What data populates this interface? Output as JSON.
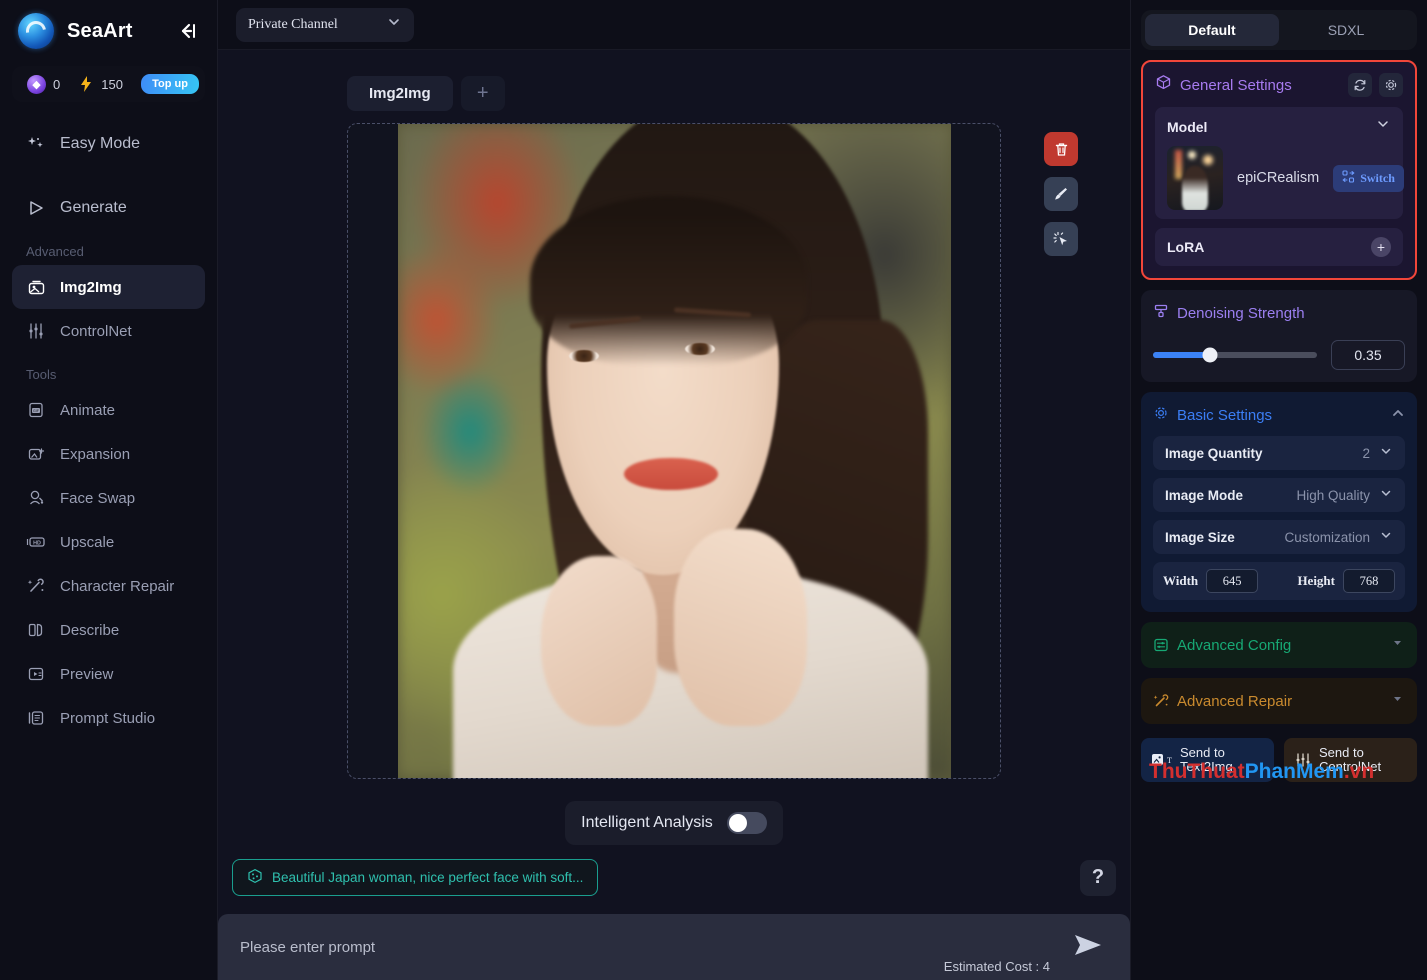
{
  "sidebar": {
    "brand": "SeaArt",
    "collapse_icon": "collapse-left-icon",
    "credits": {
      "gem_icon": "gem-icon",
      "gem_value": "0",
      "bolt_icon": "bolt-icon",
      "bolt_value": "150",
      "topup_label": "Top up"
    },
    "primary": [
      {
        "label": "Easy Mode",
        "icon": "sparkles-icon"
      },
      {
        "label": "Generate",
        "icon": "play-icon"
      }
    ],
    "advanced_label": "Advanced",
    "advanced": [
      {
        "label": "Img2Img",
        "icon": "img2img-icon",
        "active": true
      },
      {
        "label": "ControlNet",
        "icon": "sliders-icon",
        "active": false
      }
    ],
    "tools_label": "Tools",
    "tools": [
      {
        "label": "Animate",
        "icon": "gif-icon"
      },
      {
        "label": "Expansion",
        "icon": "expand-image-icon"
      },
      {
        "label": "Face Swap",
        "icon": "face-swap-icon"
      },
      {
        "label": "Upscale",
        "icon": "hd-icon"
      },
      {
        "label": "Character Repair",
        "icon": "wand-repair-icon"
      },
      {
        "label": "Describe",
        "icon": "book-icon"
      },
      {
        "label": "Preview",
        "icon": "preview-icon"
      },
      {
        "label": "Prompt Studio",
        "icon": "prompt-studio-icon"
      }
    ]
  },
  "topbar": {
    "channel_value": "Private Channel",
    "channel_chevron": "chevron-down-icon"
  },
  "canvas": {
    "tab_label": "Img2Img",
    "add_tab_label": "+",
    "image_alt": "uploaded portrait photo of a young woman",
    "tools": [
      {
        "name": "delete-image-button",
        "icon": "trash-icon"
      },
      {
        "name": "inpaint-brush-button",
        "icon": "brush-icon"
      },
      {
        "name": "magic-select-button",
        "icon": "magic-cursor-icon"
      }
    ],
    "intelligent_analysis_label": "Intelligent Analysis",
    "intelligent_analysis_on": false,
    "prompt_chip": "Beautiful Japan woman, nice perfect face with soft...",
    "prompt_chip_icon": "dice-icon",
    "help_label": "?",
    "prompt_placeholder": "Please enter prompt",
    "prompt_value": "",
    "estimated_cost": "Estimated Cost : 4",
    "send_icon": "send-icon"
  },
  "right_panel": {
    "tabs": [
      {
        "label": "Default",
        "active": true
      },
      {
        "label": "SDXL",
        "active": false
      }
    ],
    "general_settings": {
      "title": "General Settings",
      "icon": "cube-icon",
      "refresh_icon": "refresh-icon",
      "gear_icon": "gear-icon",
      "model_label": "Model",
      "model_chevron": "chevron-down-icon",
      "model_name": "epiCRealism",
      "switch_label": "Switch",
      "switch_icon": "switch-icon",
      "lora_label": "LoRA",
      "lora_add_icon": "plus-icon",
      "highlight_color": "#f2463a"
    },
    "denoising": {
      "title": "Denoising Strength",
      "icon": "denoise-icon",
      "value": "0.35",
      "percent": 35
    },
    "basic_settings": {
      "title": "Basic Settings",
      "icon": "gear-outline-icon",
      "collapse_icon": "caret-up-icon",
      "rows": [
        {
          "label": "Image Quantity",
          "value": "2"
        },
        {
          "label": "Image Mode",
          "value": "High Quality"
        },
        {
          "label": "Image Size",
          "value": "Customization"
        }
      ],
      "width_label": "Width",
      "width_value": "645",
      "height_label": "Height",
      "height_value": "768"
    },
    "advanced_config": {
      "title": "Advanced Config",
      "icon": "config-icon",
      "caret": "caret-down-icon",
      "color": "#17a874"
    },
    "advanced_repair": {
      "title": "Advanced Repair",
      "icon": "wand-repair-icon",
      "caret": "caret-down-icon",
      "color": "#c98a2e"
    },
    "send_to": [
      {
        "line1": "Send to",
        "line2": "Text2Img",
        "icon": "image-text-icon"
      },
      {
        "line1": "Send to",
        "line2": "ControlNet",
        "icon": "controlnet-icon"
      }
    ]
  },
  "watermark": {
    "part1": "ThuThuat",
    "part2": "PhanMem",
    "part3": ".vn"
  }
}
